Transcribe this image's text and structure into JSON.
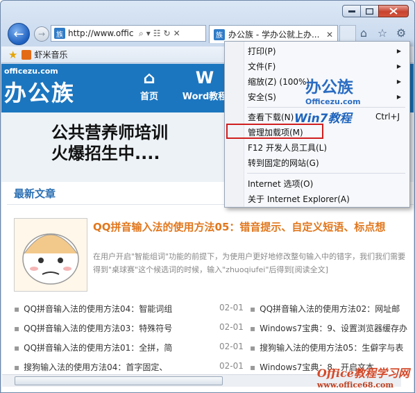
{
  "window": {
    "address": "http://www.offic",
    "tab_title": "办公族 - 学办公就上办...",
    "favicon_text": "族"
  },
  "favorites": {
    "item_label": "虾米音乐"
  },
  "site": {
    "logo_small": "officezu.com",
    "logo_big": "办公族",
    "nav": [
      {
        "label": "首页",
        "icon": "home-icon"
      },
      {
        "label": "Word教程",
        "icon": "word-icon"
      }
    ],
    "banner_line1": "公共营养师培训",
    "banner_line2": "火爆招生中....",
    "section_title": "最新文章",
    "article": {
      "title": "QQ拼音输入法的使用方法05：错音提示、自定义短语、标点想",
      "desc": "在用户开启\"智能组词\"功能的前提下，为使用户更好地修改整句输入中的错字，我们我们需要得到\"桌球赛\"这个候选词的时候，输入\"zhuoqiufei\"后得到[阅读全文]"
    },
    "list_left": [
      {
        "title": "QQ拼音输入法的使用方法04：智能词组",
        "date": "02-01"
      },
      {
        "title": "QQ拼音输入法的使用方法03：特殊符号",
        "date": "02-01"
      },
      {
        "title": "QQ拼音输入法的使用方法01：全拼，简",
        "date": "02-01"
      },
      {
        "title": "搜狗输入法的使用方法04：首字固定、",
        "date": "02-01"
      }
    ],
    "list_right": [
      {
        "title": "QQ拼音输入法的使用方法02：网址邮"
      },
      {
        "title": "Windows7宝典：9、设置浏览器缓存办"
      },
      {
        "title": "搜狗输入法的使用方法05：生僻字与表"
      },
      {
        "title": "Windows7宝典：8、开启文本"
      }
    ]
  },
  "menu": {
    "items": [
      {
        "label": "打印(P)",
        "submenu": true
      },
      {
        "label": "文件(F)",
        "submenu": true
      },
      {
        "label": "缩放(Z) (100%)",
        "submenu": true
      },
      {
        "label": "安全(S)",
        "submenu": true
      },
      {
        "label": "查看下载(N)",
        "shortcut": "Ctrl+J"
      },
      {
        "label": "管理加载项(M)"
      },
      {
        "label": "F12 开发人员工具(L)"
      },
      {
        "label": "转到固定的网站(G)"
      },
      {
        "label": "Internet 选项(O)"
      },
      {
        "label": "关于 Internet Explorer(A)"
      }
    ],
    "brand_big": "办公族",
    "brand_small": "Officezu.com",
    "win7_label": "Win7教程"
  },
  "watermark": {
    "line1": "Office教程学习网",
    "line2": "www.office68.com"
  },
  "colors": {
    "accent": "#1c76bf",
    "article_title": "#e1771d",
    "highlight": "#d01e1e"
  }
}
